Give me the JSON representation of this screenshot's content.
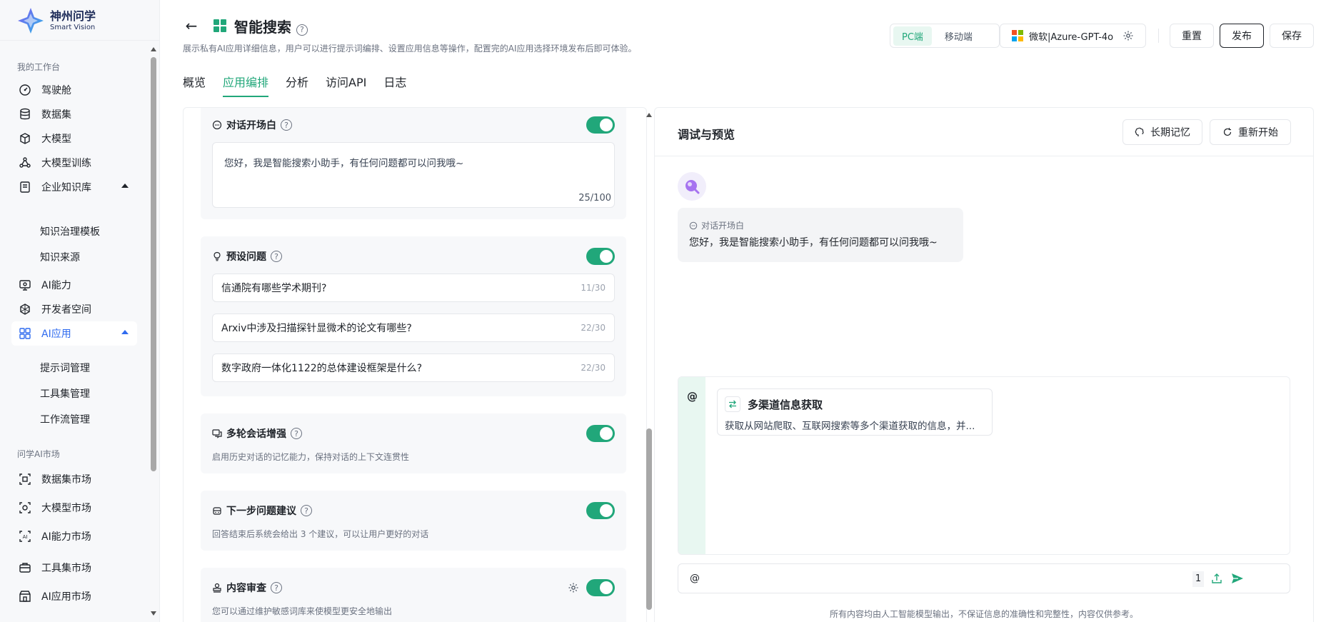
{
  "brand": {
    "name": "神州问学",
    "subtitle": "Smart Vision"
  },
  "sidebar": {
    "workspace_title": "我的工作台",
    "items": [
      {
        "label": "驾驶舱",
        "icon": "dashboard-icon"
      },
      {
        "label": "数据集",
        "icon": "database-icon"
      },
      {
        "label": "大模型",
        "icon": "cube-icon"
      },
      {
        "label": "大模型训练",
        "icon": "training-icon"
      },
      {
        "label": "企业知识库",
        "icon": "knowledge-icon",
        "expanded": true
      },
      {
        "label": "AI能力",
        "icon": "ai-ability-icon"
      },
      {
        "label": "开发者空间",
        "icon": "developer-icon"
      },
      {
        "label": "AI应用",
        "icon": "app-grid-icon",
        "expanded": true,
        "active": true
      }
    ],
    "knowledge_sub": [
      "知识治理模板",
      "知识来源"
    ],
    "app_sub": [
      "提示词管理",
      "工具集管理",
      "工作流管理"
    ],
    "market_title": "问学AI市场",
    "market_items": [
      {
        "label": "数据集市场",
        "icon": "dataset-market-icon"
      },
      {
        "label": "大模型市场",
        "icon": "model-market-icon"
      },
      {
        "label": "AI能力市场",
        "icon": "ai-market-icon"
      },
      {
        "label": "工具集市场",
        "icon": "toolbox-icon"
      },
      {
        "label": "AI应用市场",
        "icon": "store-icon"
      }
    ]
  },
  "header": {
    "title": "智能搜索",
    "description": "展示私有AI应用详细信息，用户可以进行提示词编排、设置应用信息等操作，配置完的AI应用选择环境发布后即可体验。",
    "tabs": [
      "概览",
      "应用编排",
      "分析",
      "访问API",
      "日志"
    ],
    "active_tab": "应用编排",
    "platform_options": [
      "PC端",
      "移动端"
    ],
    "platform_selected": "PC端",
    "model": "微软|Azure-GPT-4o",
    "reset_label": "重置",
    "publish_label": "发布",
    "save_label": "保存"
  },
  "config": {
    "opening": {
      "title": "对话开场白",
      "enabled": true,
      "text": "您好，我是智能搜索小助手，有任何问题都可以问我哦~",
      "count": "25/100"
    },
    "preset": {
      "title": "预设问题",
      "enabled": true,
      "questions": [
        {
          "text": "信通院有哪些学术期刊?",
          "count": "11/30"
        },
        {
          "text": "Arxiv中涉及扫描探针显微术的论文有哪些?",
          "count": "22/30"
        },
        {
          "text": "数字政府一体化1122的总体建设框架是什么?",
          "count": "22/30"
        }
      ]
    },
    "multi_turn": {
      "title": "多轮会话增强",
      "enabled": true,
      "desc": "启用历史对话的记忆能力，保持对话的上下文连贯性"
    },
    "next_suggest": {
      "title": "下一步问题建议",
      "enabled": true,
      "desc": "回答结束后系统会给出 3 个建议，可以让用户更好的对话"
    },
    "moderation": {
      "title": "内容审查",
      "enabled": true,
      "desc": "您可以通过维护敏感词库来使模型更安全地输出"
    }
  },
  "preview": {
    "title": "调试与预览",
    "memory_label": "长期记忆",
    "restart_label": "重新开始",
    "opening_label": "对话开场白",
    "opening_text": "您好，我是智能搜索小助手，有任何问题都可以问我哦~",
    "mention_symbol": "@",
    "tool": {
      "name": "多渠道信息获取",
      "desc": "获取从网站爬取、互联网搜索等多个渠道获取的信息，并..."
    },
    "input_value": "@",
    "input_count": "1",
    "disclaimer": "所有内容均由人工智能模型输出，不保证信息的准确性和完整性，内容仅供参考。"
  },
  "colors": {
    "accent": "#21a77a",
    "nav_active": "#2f6bef"
  }
}
